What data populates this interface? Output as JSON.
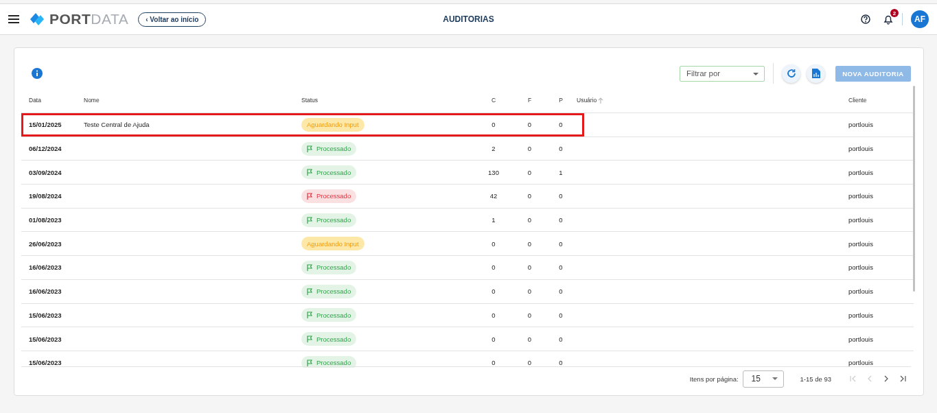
{
  "header": {
    "logo_strong": "PORT",
    "logo_light": "DATA",
    "back_button": "‹ Voltar ao início",
    "title": "AUDITORIAS",
    "notifications_count": "2",
    "avatar": "AF"
  },
  "toolbar": {
    "filter": {
      "placeholder": "Filtrar por"
    },
    "new_button": {
      "label": "NOVA AUDITORIA",
      "disabled": true
    }
  },
  "table": {
    "columns": [
      "Data",
      "Nome",
      "Status",
      "C",
      "F",
      "P",
      "Usuário",
      "Cliente"
    ],
    "rows": [
      {
        "date": "15/01/2025",
        "name": "Teste Central de Ajuda",
        "status": {
          "kind": "waiting",
          "label": "Aguardando Input"
        },
        "c": "0",
        "f": "0",
        "p": "0",
        "client": "portlouis",
        "highlighted": true
      },
      {
        "date": "06/12/2024",
        "status": {
          "kind": "done",
          "label": "Processado"
        },
        "c": "2",
        "f": "0",
        "p": "0",
        "client": "portlouis",
        "highlighted": false
      },
      {
        "date": "03/09/2024",
        "status": {
          "kind": "done",
          "label": "Processado"
        },
        "c": "130",
        "f": "0",
        "p": "1",
        "client": "portlouis",
        "highlighted": false
      },
      {
        "date": "19/08/2024",
        "status": {
          "kind": "error",
          "label": "Processado"
        },
        "c": "42",
        "f": "0",
        "p": "0",
        "client": "portlouis",
        "highlighted": false
      },
      {
        "date": "01/08/2023",
        "status": {
          "kind": "done",
          "label": "Processado"
        },
        "c": "1",
        "f": "0",
        "p": "0",
        "client": "portlouis",
        "highlighted": false
      },
      {
        "date": "26/06/2023",
        "status": {
          "kind": "waiting",
          "label": "Aguardando Input"
        },
        "c": "0",
        "f": "0",
        "p": "0",
        "client": "portlouis",
        "highlighted": false
      },
      {
        "date": "16/06/2023",
        "status": {
          "kind": "done",
          "label": "Processado"
        },
        "c": "0",
        "f": "0",
        "p": "0",
        "client": "portlouis",
        "highlighted": false
      },
      {
        "date": "16/06/2023",
        "status": {
          "kind": "done",
          "label": "Processado"
        },
        "c": "0",
        "f": "0",
        "p": "0",
        "client": "portlouis",
        "highlighted": false
      },
      {
        "date": "15/06/2023",
        "status": {
          "kind": "done",
          "label": "Processado"
        },
        "c": "0",
        "f": "0",
        "p": "0",
        "client": "portlouis",
        "highlighted": false
      },
      {
        "date": "15/06/2023",
        "status": {
          "kind": "done",
          "label": "Processado"
        },
        "c": "0",
        "f": "0",
        "p": "0",
        "client": "portlouis",
        "highlighted": false
      },
      {
        "date": "15/06/2023",
        "status": {
          "kind": "done",
          "label": "Processado"
        },
        "c": "0",
        "f": "0",
        "p": "0",
        "client": "portlouis",
        "highlighted": false
      }
    ]
  },
  "pagination": {
    "label": "Itens por página:",
    "page_size": "15",
    "range": "1-15 de 93"
  }
}
